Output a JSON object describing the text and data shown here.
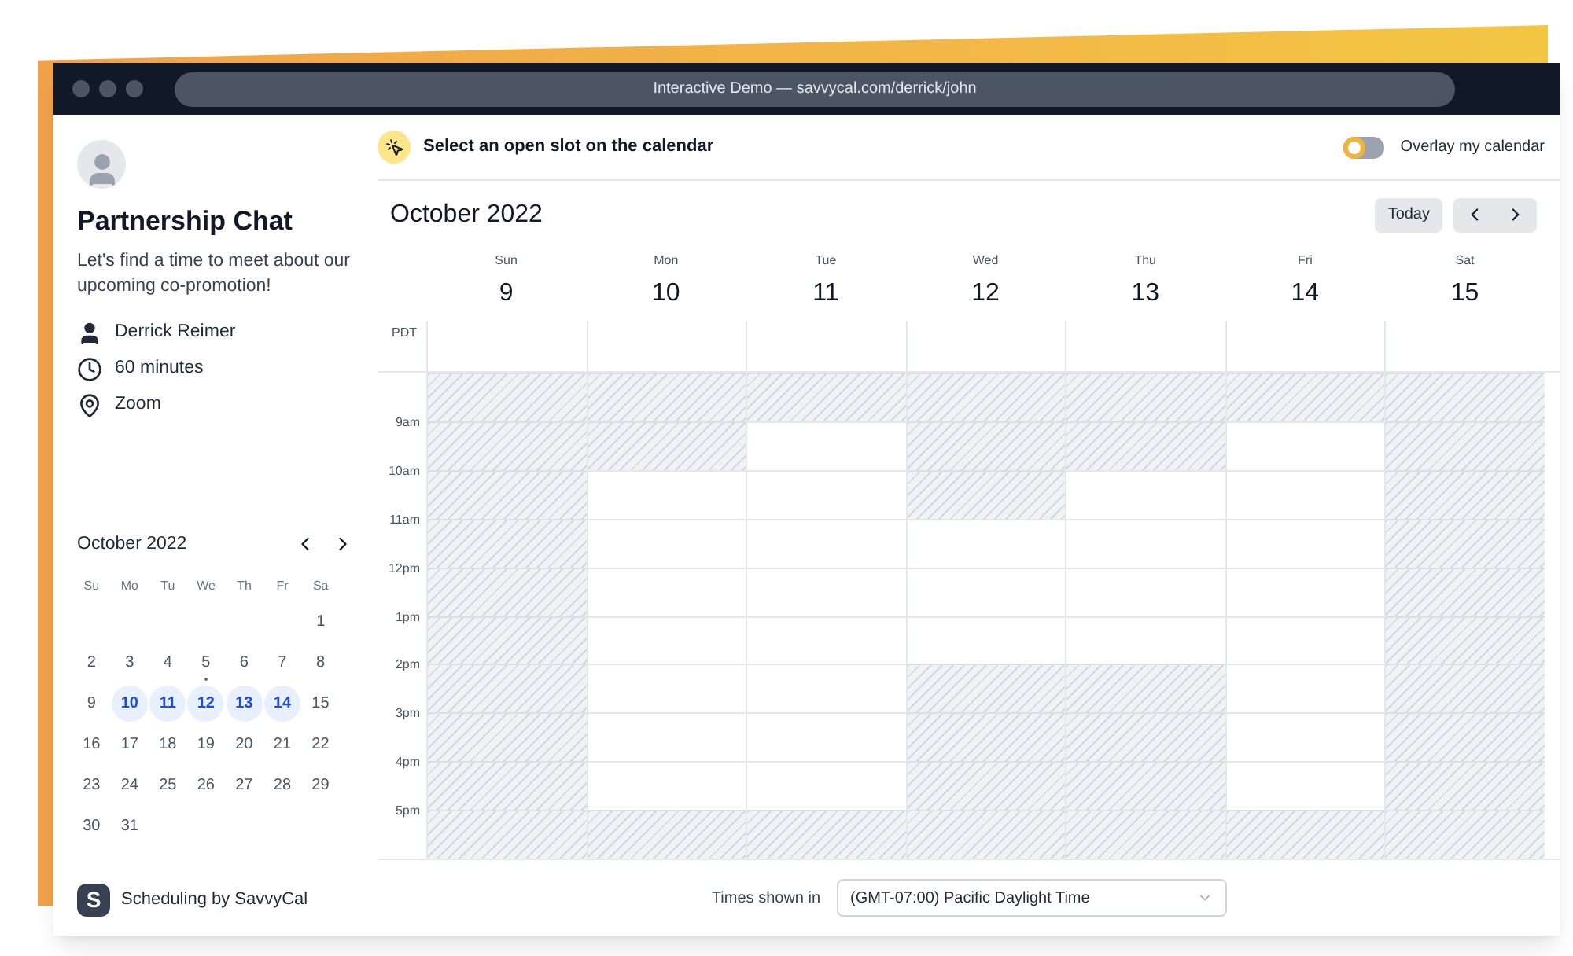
{
  "browser": {
    "address": "Interactive Demo — savvycal.com/derrick/john"
  },
  "sidebar": {
    "title": "Partnership Chat",
    "description": "Let's find a time to meet about our upcoming co-promotion!",
    "details": [
      {
        "kind": "person",
        "text": "Derrick Reimer"
      },
      {
        "kind": "clock",
        "text": "60 minutes"
      },
      {
        "kind": "location",
        "text": "Zoom"
      }
    ],
    "mini_calendar": {
      "month": "October 2022",
      "weekdays": [
        "Su",
        "Mo",
        "Tu",
        "We",
        "Th",
        "Fr",
        "Sa"
      ],
      "weeks": [
        {
          "kind": "first",
          "days": [
            {
              "label": "1",
              "highlighted": false,
              "dot": false
            }
          ]
        },
        {
          "kind": "full",
          "days": [
            {
              "label": "2",
              "highlighted": false,
              "dot": false
            },
            {
              "label": "3",
              "highlighted": false,
              "dot": false
            },
            {
              "label": "4",
              "highlighted": false,
              "dot": false
            },
            {
              "label": "5",
              "highlighted": false,
              "dot": true
            },
            {
              "label": "6",
              "highlighted": false,
              "dot": false
            },
            {
              "label": "7",
              "highlighted": false,
              "dot": false
            },
            {
              "label": "8",
              "highlighted": false,
              "dot": false
            }
          ]
        },
        {
          "kind": "full",
          "days": [
            {
              "label": "9",
              "highlighted": false,
              "dot": false
            },
            {
              "label": "10",
              "highlighted": true,
              "dot": false
            },
            {
              "label": "11",
              "highlighted": true,
              "dot": false
            },
            {
              "label": "12",
              "highlighted": true,
              "dot": false
            },
            {
              "label": "13",
              "highlighted": true,
              "dot": false
            },
            {
              "label": "14",
              "highlighted": true,
              "dot": false
            },
            {
              "label": "15",
              "highlighted": false,
              "dot": false
            }
          ]
        },
        {
          "kind": "full",
          "days": [
            {
              "label": "16",
              "highlighted": false,
              "dot": false
            },
            {
              "label": "17",
              "highlighted": false,
              "dot": false
            },
            {
              "label": "18",
              "highlighted": false,
              "dot": false
            },
            {
              "label": "19",
              "highlighted": false,
              "dot": false
            },
            {
              "label": "20",
              "highlighted": false,
              "dot": false
            },
            {
              "label": "21",
              "highlighted": false,
              "dot": false
            },
            {
              "label": "22",
              "highlighted": false,
              "dot": false
            }
          ]
        },
        {
          "kind": "full",
          "days": [
            {
              "label": "23",
              "highlighted": false,
              "dot": false
            },
            {
              "label": "24",
              "highlighted": false,
              "dot": false
            },
            {
              "label": "25",
              "highlighted": false,
              "dot": false
            },
            {
              "label": "26",
              "highlighted": false,
              "dot": false
            },
            {
              "label": "27",
              "highlighted": false,
              "dot": false
            },
            {
              "label": "28",
              "highlighted": false,
              "dot": false
            },
            {
              "label": "29",
              "highlighted": false,
              "dot": false
            }
          ]
        },
        {
          "kind": "last",
          "days": [
            {
              "label": "30",
              "highlighted": false,
              "dot": false
            },
            {
              "label": "31",
              "highlighted": false,
              "dot": false
            }
          ]
        }
      ]
    },
    "branding": {
      "logo_letter": "S",
      "text": "Scheduling by SavvyCal"
    }
  },
  "instruction": "Select an open slot on the calendar",
  "overlay_toggle": {
    "label": "Overlay my calendar",
    "on": false
  },
  "calendar": {
    "month": "October 2022",
    "today_button": "Today",
    "timezone_abbr": "PDT",
    "time_labels": [
      "9am",
      "10am",
      "11am",
      "12pm",
      "1pm",
      "2pm",
      "3pm",
      "4pm",
      "5pm"
    ],
    "days": [
      {
        "weekday": "Sun",
        "date": "9",
        "open": [
          false,
          false,
          false,
          false,
          false,
          false,
          false,
          false,
          false,
          false
        ]
      },
      {
        "weekday": "Mon",
        "date": "10",
        "open": [
          false,
          false,
          true,
          true,
          true,
          true,
          true,
          true,
          true,
          false
        ]
      },
      {
        "weekday": "Tue",
        "date": "11",
        "open": [
          false,
          true,
          true,
          true,
          true,
          true,
          true,
          true,
          true,
          false
        ]
      },
      {
        "weekday": "Wed",
        "date": "12",
        "open": [
          false,
          false,
          false,
          true,
          true,
          true,
          false,
          false,
          false,
          false
        ]
      },
      {
        "weekday": "Thu",
        "date": "13",
        "open": [
          false,
          false,
          true,
          true,
          true,
          true,
          false,
          false,
          false,
          false
        ]
      },
      {
        "weekday": "Fri",
        "date": "14",
        "open": [
          false,
          true,
          true,
          true,
          true,
          true,
          true,
          true,
          true,
          false
        ]
      },
      {
        "weekday": "Sat",
        "date": "15",
        "open": [
          false,
          false,
          false,
          false,
          false,
          false,
          false,
          false,
          false,
          false
        ]
      }
    ]
  },
  "timezone": {
    "label": "Times shown in",
    "value": "(GMT-07:00) Pacific Daylight Time"
  }
}
